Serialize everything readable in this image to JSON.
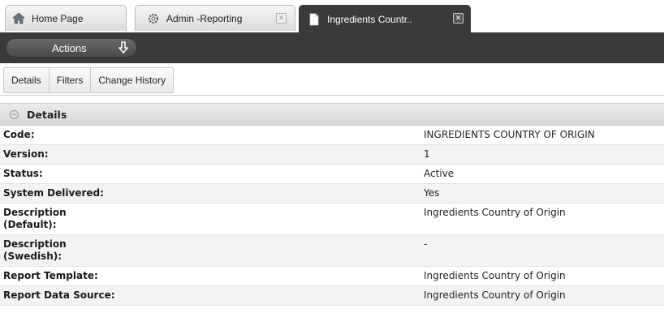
{
  "tabs": [
    {
      "label": "Home Page",
      "icon": "home-icon",
      "active": false,
      "closable": false
    },
    {
      "label": "Admin -Reporting",
      "icon": "gear-icon",
      "active": false,
      "closable": true
    },
    {
      "label": "Ingredients Countr..",
      "icon": "document-icon",
      "active": true,
      "closable": true
    }
  ],
  "actions": {
    "label": "Actions",
    "icon": "download-arrow-icon"
  },
  "subtabs": [
    "Details",
    "Filters",
    "Change History"
  ],
  "section": {
    "title": "Details",
    "rows": [
      {
        "label": "Code:",
        "value": "INGREDIENTS COUNTRY OF ORIGIN"
      },
      {
        "label": "Version:",
        "value": "1"
      },
      {
        "label": "Status:",
        "value": "Active"
      },
      {
        "label": "System Delivered:",
        "value": "Yes"
      },
      {
        "label": "Description (Default):",
        "value": "Ingredients Country of Origin"
      },
      {
        "label": "Description (Swedish):",
        "value": "-"
      },
      {
        "label": "Report Template:",
        "value": "Ingredients Country of Origin"
      },
      {
        "label": "Report Data Source:",
        "value": "Ingredients Country of Origin"
      }
    ]
  },
  "colors": {
    "dark_bar": "#3a3a3a",
    "tab_bg": "#e6e6e6",
    "row_alt": "#f3f3f3"
  }
}
